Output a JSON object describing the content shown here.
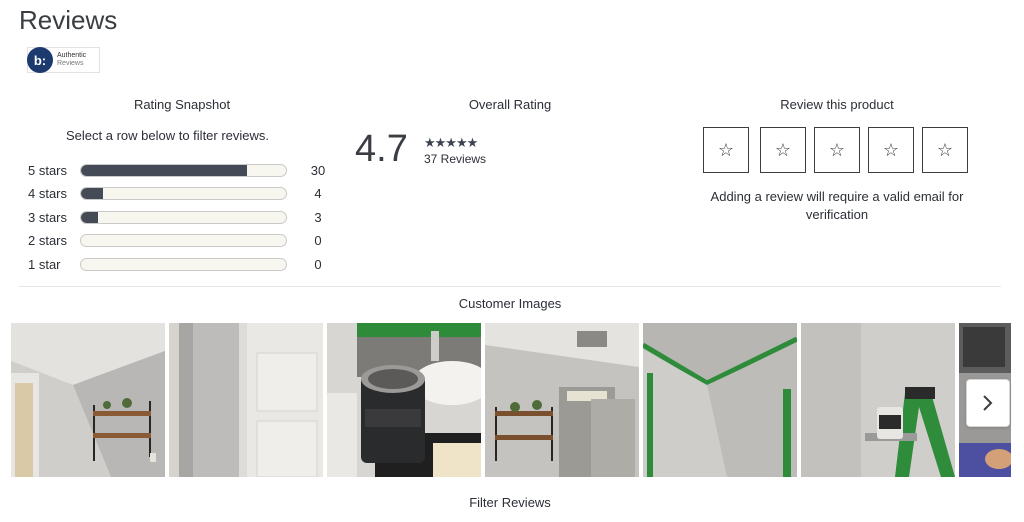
{
  "page": {
    "title": "Reviews"
  },
  "badge": {
    "logo": "b:",
    "line1": "Authentic",
    "line2": "Reviews"
  },
  "snapshot": {
    "heading": "Rating Snapshot",
    "hint": "Select a row below to filter reviews.",
    "rows": [
      {
        "label": "5 stars",
        "count": "30",
        "fraction": 0.811
      },
      {
        "label": "4 stars",
        "count": "4",
        "fraction": 0.108
      },
      {
        "label": "3 stars",
        "count": "3",
        "fraction": 0.081
      },
      {
        "label": "2 stars",
        "count": "0",
        "fraction": 0
      },
      {
        "label": "1 star",
        "count": "0",
        "fraction": 0
      }
    ]
  },
  "overall": {
    "heading": "Overall Rating",
    "value": "4.7",
    "stars": "★★★★★",
    "reviews_label": "37 Reviews"
  },
  "write_review": {
    "heading": "Review this product",
    "star_glyph": "☆",
    "note": "Adding a review will require a valid email for verification"
  },
  "images": {
    "heading": "Customer Images",
    "thumb_icons": [
      "bathroom-shelf-photo",
      "door-photo",
      "paint-can-photo",
      "bathroom-vanity-photo",
      "ceiling-corner-photo",
      "ladder-paint-photo",
      "partial-photo"
    ]
  },
  "filter": {
    "heading": "Filter Reviews"
  },
  "colors": {
    "bar_fill": "#444a56",
    "bar_track": "#f7f6ef",
    "badge_blue": "#1d3a6e"
  }
}
